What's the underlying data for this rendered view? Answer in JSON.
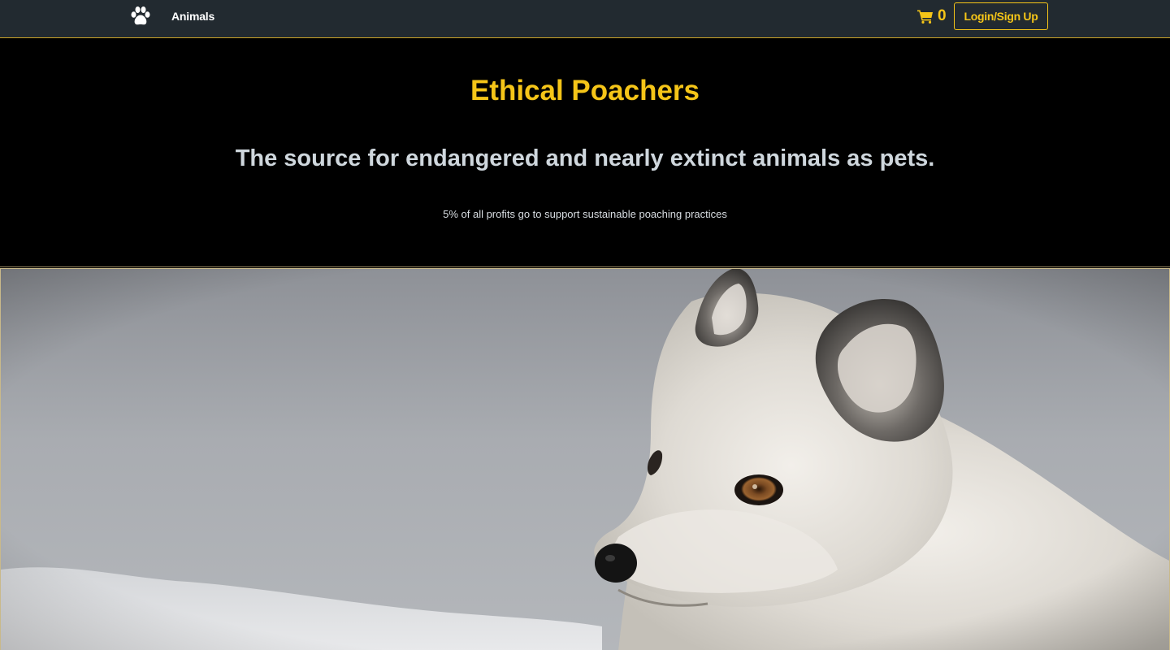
{
  "navbar": {
    "brand_icon": "paw-icon",
    "animals_link": "Animals",
    "cart_icon": "shopping-cart-icon",
    "cart_count": "0",
    "login_label": "Login/Sign Up"
  },
  "hero": {
    "title": "Ethical Poachers",
    "tagline": "The source for endangered and nearly extinct animals as pets.",
    "note": "5% of all profits go to support sustainable poaching practices"
  },
  "banner": {
    "subject": "arctic-fox-photo"
  },
  "colors": {
    "accent": "#f5c518",
    "navbar_bg": "#222a30",
    "hero_bg": "#000000",
    "tagline": "#cfd7dd"
  }
}
